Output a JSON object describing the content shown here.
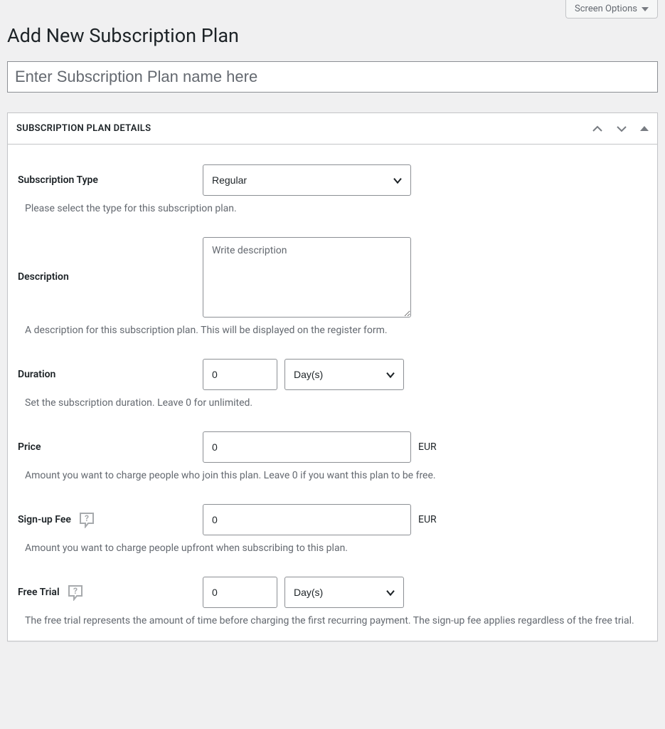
{
  "topbar": {
    "screen_options": "Screen Options"
  },
  "page": {
    "title": "Add New Subscription Plan"
  },
  "name_input": {
    "placeholder": "Enter Subscription Plan name here"
  },
  "panel": {
    "title": "SUBSCRIPTION PLAN DETAILS"
  },
  "fields": {
    "subscription_type": {
      "label": "Subscription Type",
      "value": "Regular",
      "help": "Please select the type for this subscription plan."
    },
    "description": {
      "label": "Description",
      "placeholder": "Write description",
      "help": "A description for this subscription plan. This will be displayed on the register form."
    },
    "duration": {
      "label": "Duration",
      "value": "0",
      "unit": "Day(s)",
      "help": "Set the subscription duration. Leave 0 for unlimited."
    },
    "price": {
      "label": "Price",
      "value": "0",
      "currency": "EUR",
      "help": "Amount you want to charge people who join this plan. Leave 0 if you want this plan to be free."
    },
    "signup_fee": {
      "label": "Sign-up Fee",
      "value": "0",
      "currency": "EUR",
      "help": "Amount you want to charge people upfront when subscribing to this plan."
    },
    "free_trial": {
      "label": "Free Trial",
      "value": "0",
      "unit": "Day(s)",
      "help": "The free trial represents the amount of time before charging the first recurring payment. The sign-up fee applies regardless of the free trial."
    }
  }
}
